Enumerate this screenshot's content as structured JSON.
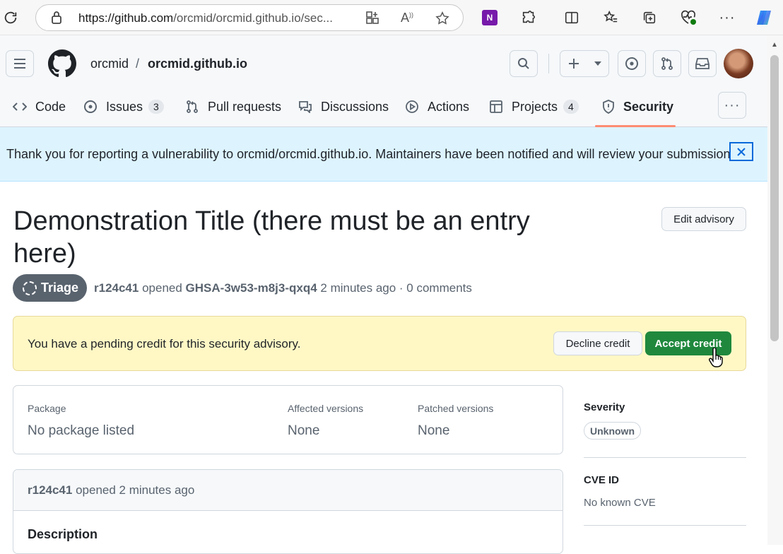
{
  "browser": {
    "url_host": "https://github.com",
    "url_rest": "/orcmid/orcmid.github.io/sec..."
  },
  "header": {
    "owner": "orcmid",
    "separator": "/",
    "repo": "orcmid.github.io"
  },
  "tabs": [
    {
      "label": "Code",
      "icon": "code-icon"
    },
    {
      "label": "Issues",
      "count": "3",
      "icon": "issue-icon"
    },
    {
      "label": "Pull requests",
      "icon": "pull-request-icon"
    },
    {
      "label": "Discussions",
      "icon": "discussion-icon"
    },
    {
      "label": "Actions",
      "icon": "play-icon"
    },
    {
      "label": "Projects",
      "count": "4",
      "icon": "table-icon"
    },
    {
      "label": "Security",
      "icon": "shield-icon",
      "selected": true
    }
  ],
  "flash": {
    "message": "Thank you for reporting a vulnerability to orcmid/orcmid.github.io. Maintainers have been notified and will review your submission."
  },
  "advisory": {
    "title": "Demonstration Title (there must be an entry here)",
    "edit_label": "Edit advisory",
    "state": "Triage",
    "author": "r124c41",
    "opened_text": "opened",
    "ghsa_id": "GHSA-3w53-m8j3-qxq4",
    "meta_tail": "2 minutes ago · 0 comments"
  },
  "credit": {
    "message": "You have a pending credit for this security advisory.",
    "decline_label": "Decline credit",
    "accept_label": "Accept credit"
  },
  "package": {
    "package_label": "Package",
    "package_value": "No package listed",
    "affected_label": "Affected versions",
    "affected_value": "None",
    "patched_label": "Patched versions",
    "patched_value": "None"
  },
  "comment": {
    "author": "r124c41",
    "tail": "opened 2 minutes ago",
    "description_heading": "Description"
  },
  "sidebar": {
    "severity_label": "Severity",
    "severity_value": "Unknown",
    "cve_label": "CVE ID",
    "cve_value": "No known CVE"
  },
  "colors": {
    "accept": "#1f883d",
    "flash_bg": "#ddf4ff",
    "credit_bg": "#fff8c5",
    "tab_underline": "#fd8c73"
  }
}
